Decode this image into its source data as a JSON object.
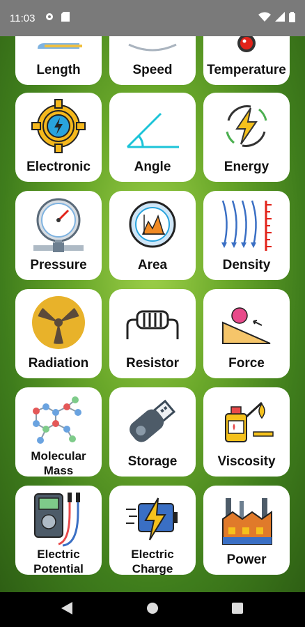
{
  "status": {
    "time": "11:03"
  },
  "icons": {
    "gear": "gear-icon",
    "sdcard": "sd-card-icon",
    "wifi": "wifi-icon",
    "signal": "signal-icon",
    "battery": "battery-icon",
    "back": "back-icon",
    "home": "home-icon",
    "recents": "recents-icon"
  },
  "tiles": [
    {
      "label": "Length"
    },
    {
      "label": "Speed"
    },
    {
      "label": "Temperature"
    },
    {
      "label": "Electronic"
    },
    {
      "label": "Angle"
    },
    {
      "label": "Energy"
    },
    {
      "label": "Pressure"
    },
    {
      "label": "Area"
    },
    {
      "label": "Density"
    },
    {
      "label": "Radiation"
    },
    {
      "label": "Resistor"
    },
    {
      "label": "Force"
    },
    {
      "label": "Molecular",
      "label2": "Mass"
    },
    {
      "label": "Storage"
    },
    {
      "label": "Viscosity"
    },
    {
      "label": "Electric",
      "label2": "Potential"
    },
    {
      "label": "Electric",
      "label2": "Charge"
    },
    {
      "label": "Power"
    }
  ]
}
